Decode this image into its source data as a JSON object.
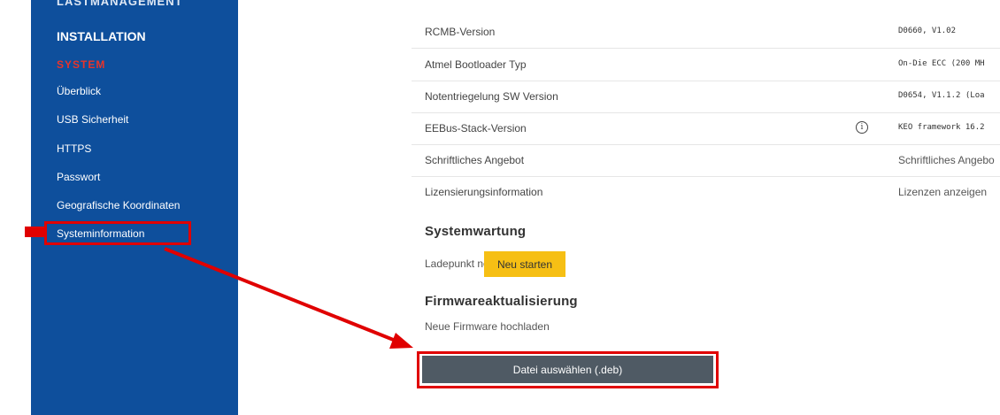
{
  "sidebar": {
    "cut_heading": "LASTMANAGEMENT",
    "installation": "INSTALLATION",
    "system": "SYSTEM",
    "items": [
      {
        "label": "Überblick"
      },
      {
        "label": "USB Sicherheit"
      },
      {
        "label": "HTTPS"
      },
      {
        "label": "Passwort"
      },
      {
        "label": "Geografische Koordinaten"
      },
      {
        "label": "Systeminformation"
      }
    ]
  },
  "info_rows": [
    {
      "label": "RCMB-Version",
      "value": "D0660, V1.02"
    },
    {
      "label": "Atmel Bootloader Typ",
      "value": "On-Die ECC (200 MH"
    },
    {
      "label": "Notentriegelung SW Version",
      "value": "D0654, V1.1.2 (Loa"
    },
    {
      "label": "EEBus-Stack-Version",
      "value": "KEO framework 16.2"
    },
    {
      "label": "Schriftliches Angebot",
      "value": "Schriftliches Angebo"
    },
    {
      "label": "Lizensierungsinformation",
      "value": "Lizenzen anzeigen"
    }
  ],
  "info_icon": "info-icon",
  "maintenance": {
    "title": "Systemwartung",
    "restart_label": "Ladepunkt neu starten",
    "restart_button": "Neu starten"
  },
  "firmware": {
    "title": "Firmwareaktualisierung",
    "upload_label": "Neue Firmware hochladen",
    "file_button": "Datei auswählen (.deb)"
  },
  "colors": {
    "sidebar_bg": "#0e4f9c",
    "system_accent": "#e8342a",
    "annotation_red": "#e00000",
    "restart_button": "#f6bf14",
    "file_button": "#4f5a64"
  }
}
